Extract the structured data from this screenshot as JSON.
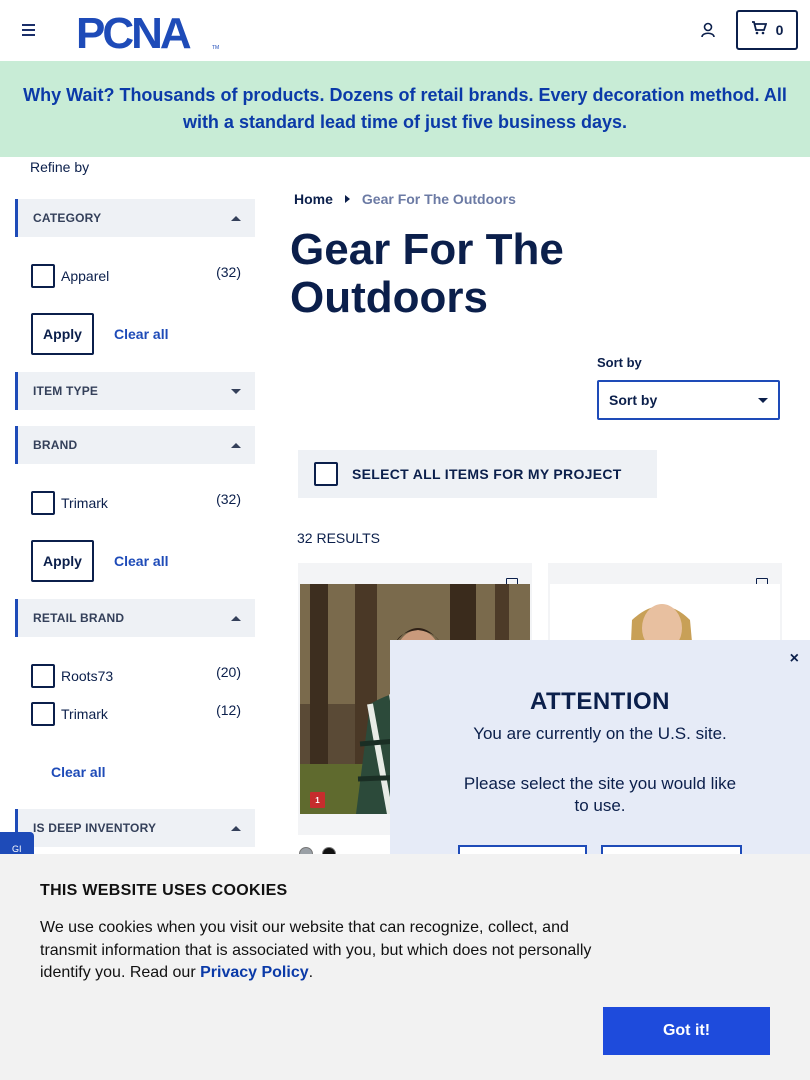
{
  "header": {
    "logo_text": "PCNA",
    "logo_tm": "TM",
    "cart_count": "0",
    "menu_icon": "hamburger-icon",
    "account_icon": "user-icon",
    "cart_icon": "cart-icon"
  },
  "promo": {
    "text": "Why Wait? Thousands of products. Dozens of retail brands. Every decoration method. All with a standard lead time of just five business days."
  },
  "sidebar": {
    "refine_label": "Refine by",
    "category": {
      "label": "CATEGORY",
      "options": [
        {
          "name": "Apparel",
          "count": "(32)"
        }
      ],
      "apply": "Apply",
      "clear": "Clear all"
    },
    "item_type": {
      "label": "ITEM TYPE"
    },
    "brand": {
      "label": "BRAND",
      "options": [
        {
          "name": "Trimark",
          "count": "(32)"
        }
      ],
      "apply": "Apply",
      "clear": "Clear all"
    },
    "retail_brand": {
      "label": "RETAIL BRAND",
      "options": [
        {
          "name": "Roots73",
          "count": "(20)"
        },
        {
          "name": "Trimark",
          "count": "(12)"
        }
      ],
      "clear": "Clear all"
    },
    "deep_inventory": {
      "label": "IS DEEP INVENTORY"
    },
    "side_tab": "GI"
  },
  "main": {
    "breadcrumb": {
      "home": "Home",
      "current": "Gear For The Outdoors"
    },
    "title": "Gear For The Outdoors",
    "sort_label": "Sort by",
    "sort_value": "Sort by",
    "select_all": "SELECT ALL ITEMS FOR MY PROJECT",
    "results": "32 RESULTS",
    "card1_badge": "1"
  },
  "attention": {
    "close": "×",
    "title": "ATTENTION",
    "message1": "You are currently on the U.S. site.",
    "message2": "Please select the site you would like to use."
  },
  "cookies": {
    "title": "THIS WEBSITE USES COOKIES",
    "text": "We use cookies when you visit our website that can recognize, collect, and transmit information that is associated with you, but which does not personally identify you. Read our ",
    "link": "Privacy Policy",
    "text_end": ".",
    "button": "Got it!"
  },
  "colors": {
    "navy": "#0b1f4b",
    "accent": "#1e4bb8",
    "promo_bg": "#c8ecd6",
    "button_blue": "#1e4bdc"
  }
}
